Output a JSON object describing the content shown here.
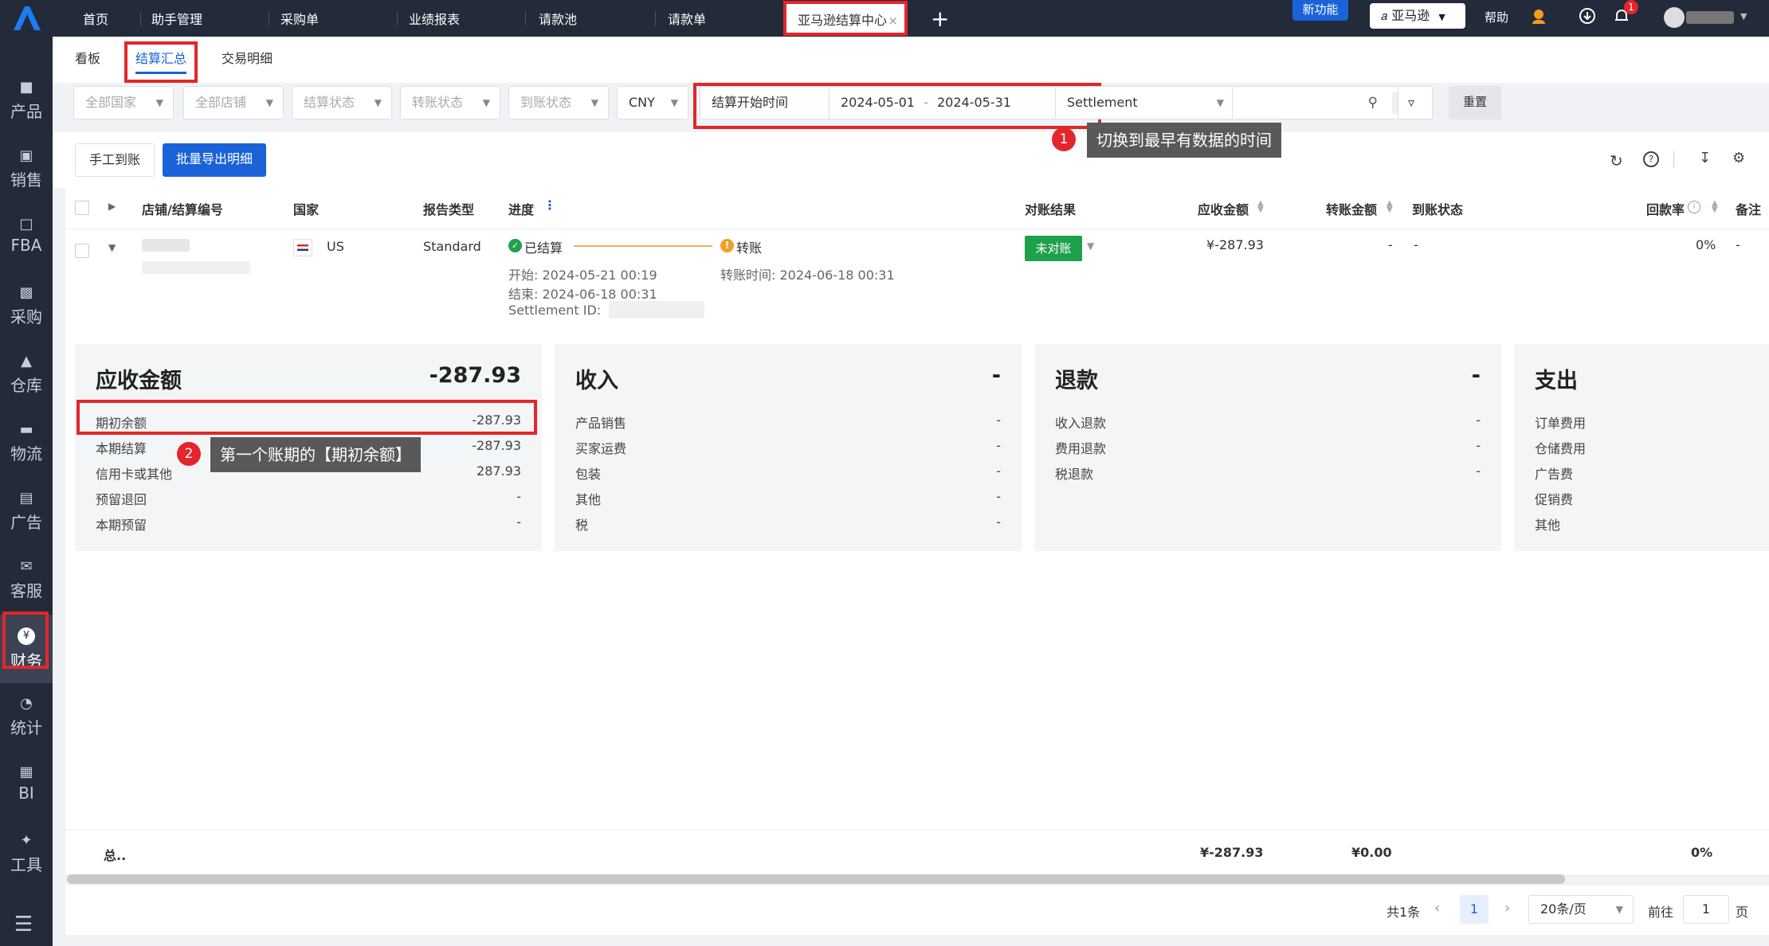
{
  "topbar": {
    "tabs": [
      "首页",
      "助手管理",
      "采购单",
      "业绩报表",
      "请款池",
      "请款单"
    ],
    "active_tab": "亚马逊结算中心",
    "close_glyph": "×",
    "add_glyph": "+",
    "new_feature": "新功能",
    "amazon_label": "亚马逊",
    "help": "帮助",
    "notif_count": "1"
  },
  "sidebar": {
    "items": [
      "产品",
      "销售",
      "FBA",
      "采购",
      "仓库",
      "物流",
      "广告",
      "客服",
      "财务",
      "统计",
      "BI",
      "工具"
    ],
    "finance_badge": "¥"
  },
  "subtabs": [
    "看板",
    "结算汇总",
    "交易明细"
  ],
  "filters": {
    "country": "全部国家",
    "store": "全部店铺",
    "settle_status": "结算状态",
    "transfer_status": "转账状态",
    "arrival_status": "到账状态",
    "currency": "CNY",
    "time_type": "结算开始时间",
    "date_start": "2024-05-01",
    "date_sep": "-",
    "date_end": "2024-05-31",
    "search_type": "Settlement",
    "reset": "重置"
  },
  "buttons": {
    "manual": "手工到账",
    "export": "批量导出明细"
  },
  "table": {
    "headers": {
      "store": "店铺/结算编号",
      "country": "国家",
      "report_type": "报告类型",
      "progress": "进度",
      "reconcile": "对账结果",
      "receivable": "应收金额",
      "transfer": "转账金额",
      "arrival": "到账状态",
      "rate": "回款率",
      "note": "备注"
    },
    "row": {
      "country": "US",
      "report_type": "Standard",
      "settled": "已结算",
      "transfer_step": "转账",
      "start": "开始: 2024-05-21 00:19",
      "end": "结束: 2024-06-18 00:31",
      "settlement_id": "Settlement ID:",
      "transfer_time": "转账时间: 2024-06-18 00:31",
      "reconcile": "未对账",
      "receivable": "¥-287.93",
      "transfer": "-",
      "arrival": "-",
      "rate": "0%",
      "note": "-"
    }
  },
  "cards": [
    {
      "title": "应收金额",
      "value": "-287.93",
      "rows": [
        {
          "label": "期初余额",
          "value": "-287.93"
        },
        {
          "label": "本期结算",
          "value": "-287.93"
        },
        {
          "label": "信用卡或其他",
          "value": "287.93"
        },
        {
          "label": "预留退回",
          "value": "-"
        },
        {
          "label": "本期预留",
          "value": "-"
        }
      ]
    },
    {
      "title": "收入",
      "value": "-",
      "rows": [
        {
          "label": "产品销售",
          "value": "-"
        },
        {
          "label": "买家运费",
          "value": "-"
        },
        {
          "label": "包装",
          "value": "-"
        },
        {
          "label": "其他",
          "value": "-"
        },
        {
          "label": "税",
          "value": "-"
        }
      ]
    },
    {
      "title": "退款",
      "value": "-",
      "rows": [
        {
          "label": "收入退款",
          "value": "-"
        },
        {
          "label": "费用退款",
          "value": "-"
        },
        {
          "label": "税退款",
          "value": "-"
        }
      ]
    },
    {
      "title": "支出",
      "value": "",
      "rows": [
        {
          "label": "订单费用",
          "value": ""
        },
        {
          "label": "仓储费用",
          "value": ""
        },
        {
          "label": "广告费",
          "value": ""
        },
        {
          "label": "促销费",
          "value": ""
        },
        {
          "label": "其他",
          "value": ""
        }
      ]
    }
  ],
  "total": {
    "label": "总..",
    "receivable": "¥-287.93",
    "transfer": "¥0.00",
    "rate": "0%"
  },
  "pager": {
    "count": "共1条",
    "page": "1",
    "page_size": "20条/页",
    "goto_label": "前往",
    "goto_value": "1",
    "page_unit": "页"
  },
  "annotations": {
    "tip1_num": "1",
    "tip1": "切换到最早有数据的时间",
    "tip2_num": "2",
    "tip2": "第一个账期的【期初余额】"
  }
}
